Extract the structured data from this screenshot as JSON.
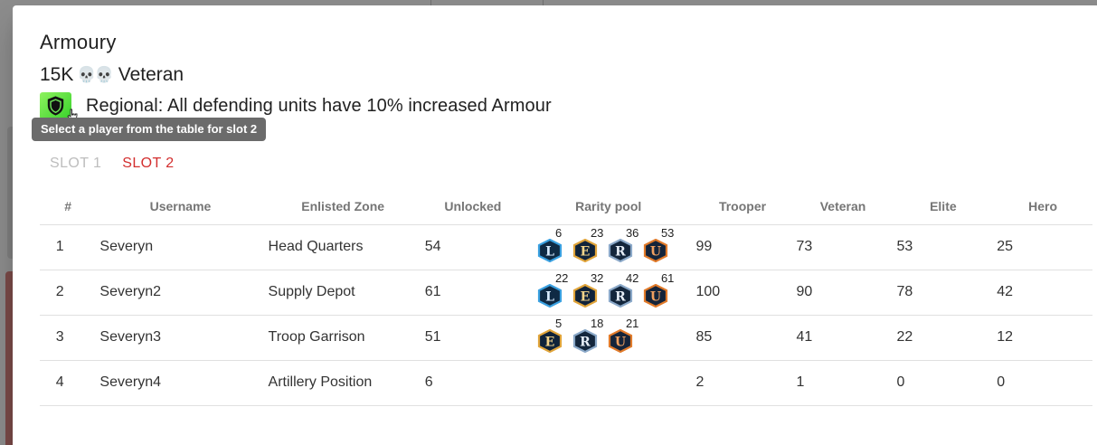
{
  "dialog": {
    "title": "Armoury",
    "subtitle_amount": "15K",
    "subtitle_icon": "skull-icon",
    "subtitle_tier": "Veteran",
    "bonus_icon": "shield-icon",
    "bonus_text": "Regional: All defending units have 10% increased Armour",
    "tooltip": "Select a player from the table for slot 2"
  },
  "tabs": [
    {
      "label": "SLOT 1",
      "active": false
    },
    {
      "label": "SLOT 2",
      "active": true
    }
  ],
  "table": {
    "headers": [
      "#",
      "Username",
      "Enlisted Zone",
      "Unlocked",
      "Rarity pool",
      "Trooper",
      "Veteran",
      "Elite",
      "Hero"
    ],
    "rows": [
      {
        "num": "1",
        "username": "Severyn",
        "zone": "Head Quarters",
        "unlocked": "54",
        "rarity": [
          {
            "letter": "L",
            "count": "6"
          },
          {
            "letter": "E",
            "count": "23"
          },
          {
            "letter": "R",
            "count": "36"
          },
          {
            "letter": "U",
            "count": "53"
          }
        ],
        "trooper": "99",
        "veteran": "73",
        "elite": "53",
        "hero": "25"
      },
      {
        "num": "2",
        "username": "Severyn2",
        "zone": "Supply Depot",
        "unlocked": "61",
        "rarity": [
          {
            "letter": "L",
            "count": "22"
          },
          {
            "letter": "E",
            "count": "32"
          },
          {
            "letter": "R",
            "count": "42"
          },
          {
            "letter": "U",
            "count": "61"
          }
        ],
        "trooper": "100",
        "veteran": "90",
        "elite": "78",
        "hero": "42"
      },
      {
        "num": "3",
        "username": "Severyn3",
        "zone": "Troop Garrison",
        "unlocked": "51",
        "rarity": [
          {
            "letter": "E",
            "count": "5"
          },
          {
            "letter": "R",
            "count": "18"
          },
          {
            "letter": "U",
            "count": "21"
          }
        ],
        "trooper": "85",
        "veteran": "41",
        "elite": "22",
        "hero": "12"
      },
      {
        "num": "4",
        "username": "Severyn4",
        "zone": "Artillery Position",
        "unlocked": "6",
        "rarity": [],
        "trooper": "2",
        "veteran": "1",
        "elite": "0",
        "hero": "0"
      }
    ]
  },
  "rarity_colors": {
    "L": {
      "border": "#3aa0e0",
      "fill": "#0f2a44",
      "text": "#d9ecff"
    },
    "E": {
      "border": "#e0a43a",
      "fill": "#10233a",
      "text": "#f6d58a"
    },
    "R": {
      "border": "#8aa8c8",
      "fill": "#13263c",
      "text": "#e6eef7"
    },
    "U": {
      "border": "#e07a2a",
      "fill": "#14243a",
      "text": "#f0a060"
    }
  }
}
